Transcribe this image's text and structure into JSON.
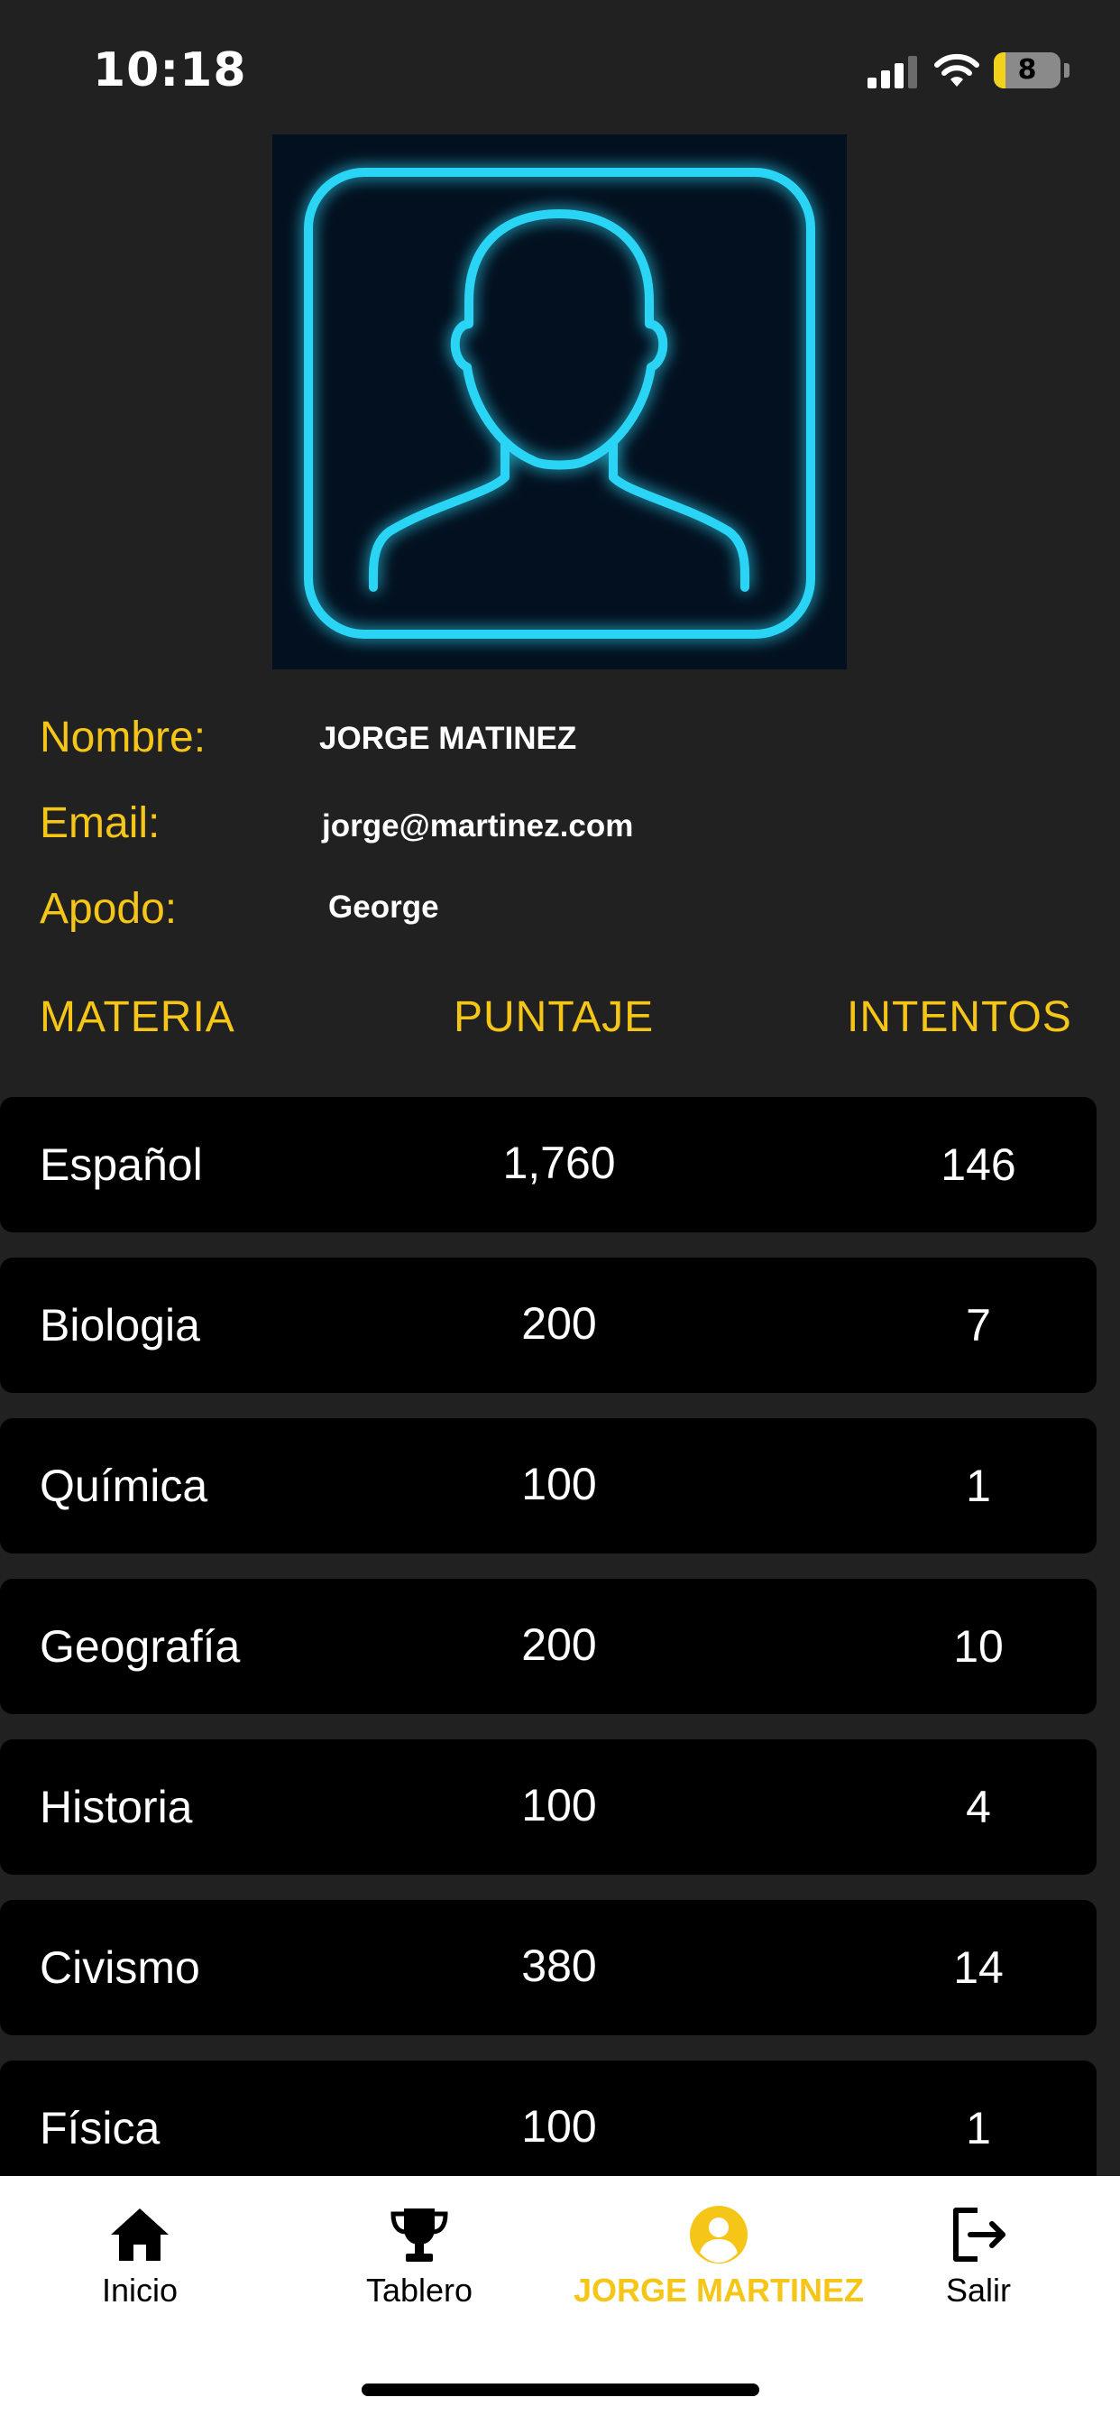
{
  "status_bar": {
    "time": "10:18",
    "battery_level": "8"
  },
  "colors": {
    "accent": "#f5c518",
    "background": "#212121",
    "row_background": "#000000",
    "neon": "#2ad4f4"
  },
  "avatar": {
    "icon": "user-silhouette-icon"
  },
  "profile": {
    "name_label": "Nombre:",
    "name_value": "JORGE MATINEZ",
    "email_label": "Email:",
    "email_value": "jorge@martinez.com",
    "nickname_label": "Apodo:",
    "nickname_value": "George"
  },
  "table": {
    "headers": {
      "subject": "MATERIA",
      "score": "PUNTAJE",
      "attempts": "INTENTOS"
    },
    "rows": [
      {
        "subject": "Español",
        "score": "1,760",
        "attempts": "146"
      },
      {
        "subject": "Biologia",
        "score": "200",
        "attempts": "7"
      },
      {
        "subject": "Química",
        "score": "100",
        "attempts": "1"
      },
      {
        "subject": "Geografía",
        "score": "200",
        "attempts": "10"
      },
      {
        "subject": "Historia",
        "score": "100",
        "attempts": "4"
      },
      {
        "subject": "Civismo",
        "score": "380",
        "attempts": "14"
      },
      {
        "subject": "Física",
        "score": "100",
        "attempts": "1"
      }
    ]
  },
  "nav": {
    "items": [
      {
        "label": "Inicio",
        "icon": "home-icon"
      },
      {
        "label": "Tablero",
        "icon": "trophy-icon"
      },
      {
        "label": "JORGE MARTINEZ",
        "icon": "user-circle-icon",
        "active": true
      },
      {
        "label": "Salir",
        "icon": "logout-icon"
      }
    ]
  }
}
